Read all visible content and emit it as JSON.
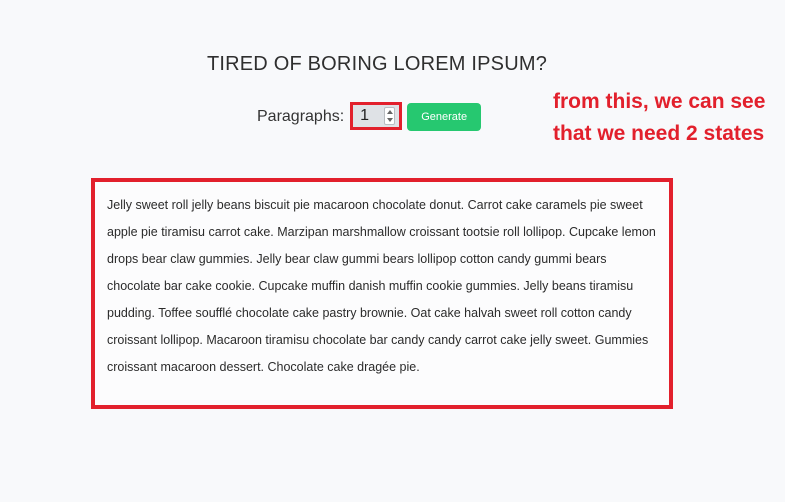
{
  "header": {
    "title": "TIRED OF BORING LOREM IPSUM?"
  },
  "controls": {
    "paragraphs_label": "Paragraphs:",
    "paragraphs_value": "1",
    "generate_label": "Generate"
  },
  "annotation": {
    "text": "from this, we can see that we need 2 states"
  },
  "output": {
    "paragraphs": [
      "Jelly sweet roll jelly beans biscuit pie macaroon chocolate donut. Carrot cake caramels pie sweet apple pie tiramisu carrot cake. Marzipan marshmallow croissant tootsie roll lollipop. Cupcake lemon drops bear claw gummies. Jelly bear claw gummi bears lollipop cotton candy gummi bears chocolate bar cake cookie. Cupcake muffin danish muffin cookie gummies. Jelly beans tiramisu pudding. Toffee soufflé chocolate cake pastry brownie. Oat cake halvah sweet roll cotton candy croissant lollipop. Macaroon tiramisu chocolate bar candy candy carrot cake jelly sweet. Gummies croissant macaroon dessert. Chocolate cake dragée pie."
    ]
  },
  "colors": {
    "background": "#f8f9fb",
    "accent_green": "#26c870",
    "annotation_red": "#e2202c",
    "input_bg": "#dfe2e6"
  }
}
